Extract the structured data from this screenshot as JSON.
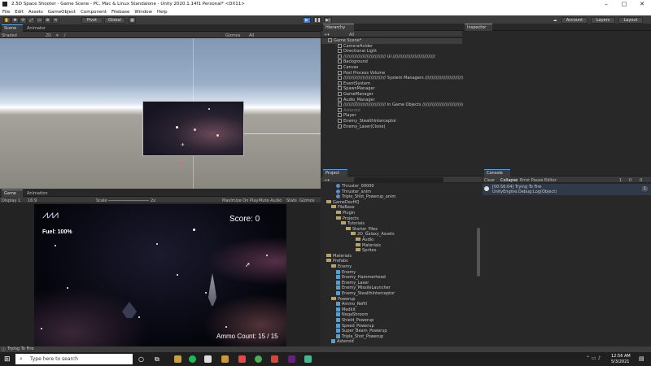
{
  "window": {
    "title": "2.5D Space Shooter - Game Scene - PC, Mac & Linux Standalone - Unity 2020.1.14f1 Personal* <DX11>",
    "minimize": "–",
    "maximize": "□",
    "close": "✕"
  },
  "menu": [
    "File",
    "Edit",
    "Assets",
    "GameObject",
    "Component",
    "Filebase",
    "Window",
    "Help"
  ],
  "toolbar": {
    "pivot": "Pivot",
    "global": "Global",
    "account": "Account",
    "layers": "Layers",
    "layout": "Layout"
  },
  "scene_tabs": {
    "scene": "Scene",
    "animator": "Animator"
  },
  "scene_bar": {
    "shading": "Shaded",
    "mode": "2D",
    "gizmos": "Gizmos",
    "search": "All"
  },
  "game_tabs": {
    "game": "Game",
    "animation": "Animation"
  },
  "game_bar": {
    "display": "Display 1",
    "aspect": "16:9",
    "scale_label": "Scale",
    "scale_value": "2x",
    "maximize": "Maximize On Play",
    "mute": "Mute Audio",
    "stats": "Stats",
    "gizmos": "Gizmos"
  },
  "hud": {
    "fuel": "Fuel: 100%",
    "score": "Score: 0",
    "ammo": "Ammo Count: 15 / 15"
  },
  "hierarchy": {
    "tab": "Hierarchy",
    "search": "All",
    "rows": [
      {
        "label": "Game Scene*",
        "indent": 0,
        "sel": true
      },
      {
        "label": "CameraHolder",
        "indent": 1
      },
      {
        "label": "Directional Light",
        "indent": 1
      },
      {
        "label": "/////////////////////////////// UI ///////////////////////////////",
        "indent": 1
      },
      {
        "label": "Background",
        "indent": 1
      },
      {
        "label": "Canvas",
        "indent": 1
      },
      {
        "label": "Post Process Volume",
        "indent": 1
      },
      {
        "label": "/////////////////////////////// System Managers ///////////////////////////////",
        "indent": 1
      },
      {
        "label": "EventSystem",
        "indent": 1
      },
      {
        "label": "SpawnManager",
        "indent": 1
      },
      {
        "label": "GameManager",
        "indent": 1
      },
      {
        "label": "Audio_Manager",
        "indent": 1
      },
      {
        "label": "/////////////////////////////// In Game Objects ///////////////////////////////",
        "indent": 1
      },
      {
        "label": "Asteroid",
        "indent": 1,
        "dim": true
      },
      {
        "label": "Player",
        "indent": 1
      },
      {
        "label": "Enemy_StealthInterceptor",
        "indent": 1
      },
      {
        "label": "Enemy_Laser(Clone)",
        "indent": 1
      }
    ]
  },
  "inspector": {
    "tab": "Inspector"
  },
  "project": {
    "tab": "Project",
    "rows": [
      {
        "label": "Thruster_00000",
        "indent": 2,
        "type": "asset"
      },
      {
        "label": "Thruster_anim",
        "indent": 2,
        "type": "asset"
      },
      {
        "label": "Triple_Shot_Powerup_anim",
        "indent": 2,
        "type": "asset"
      },
      {
        "label": "GameDevHQ",
        "indent": 0,
        "type": "folder"
      },
      {
        "label": "FileBase",
        "indent": 1,
        "type": "folder"
      },
      {
        "label": "Plugin",
        "indent": 2,
        "type": "folder"
      },
      {
        "label": "Projects",
        "indent": 2,
        "type": "folder"
      },
      {
        "label": "Tutorials",
        "indent": 3,
        "type": "folder"
      },
      {
        "label": "Starter_Files",
        "indent": 4,
        "type": "folder"
      },
      {
        "label": "2D_Galaxy_Assets",
        "indent": 5,
        "type": "folder"
      },
      {
        "label": "Audio",
        "indent": 6,
        "type": "folder"
      },
      {
        "label": "Materials",
        "indent": 6,
        "type": "folder"
      },
      {
        "label": "Sprites",
        "indent": 6,
        "type": "folder"
      },
      {
        "label": "Materials",
        "indent": 0,
        "type": "folder"
      },
      {
        "label": "Prefabs",
        "indent": 0,
        "type": "folder"
      },
      {
        "label": "Enemy",
        "indent": 1,
        "type": "folder"
      },
      {
        "label": "Enemy",
        "indent": 2,
        "type": "prefab"
      },
      {
        "label": "Enemy_Hammerhead",
        "indent": 2,
        "type": "prefab"
      },
      {
        "label": "Enemy_Laser",
        "indent": 2,
        "type": "prefab"
      },
      {
        "label": "Enemy_MissileLauncher",
        "indent": 2,
        "type": "prefab"
      },
      {
        "label": "Enemy_StealthInterceptor",
        "indent": 2,
        "type": "prefab"
      },
      {
        "label": "Powerup",
        "indent": 1,
        "type": "folder"
      },
      {
        "label": "Ammo_Refill",
        "indent": 2,
        "type": "prefab"
      },
      {
        "label": "Medkit",
        "indent": 2,
        "type": "prefab"
      },
      {
        "label": "NegaShroom",
        "indent": 2,
        "type": "prefab"
      },
      {
        "label": "Shield_Powerup",
        "indent": 2,
        "type": "prefab"
      },
      {
        "label": "Speed_Powerup",
        "indent": 2,
        "type": "prefab"
      },
      {
        "label": "Super_Beam_Powerup",
        "indent": 2,
        "type": "prefab"
      },
      {
        "label": "Triple_Shot_Powerup",
        "indent": 2,
        "type": "prefab"
      },
      {
        "label": "Asteroid",
        "indent": 1,
        "type": "prefab"
      }
    ]
  },
  "console": {
    "tab": "Console",
    "clear": "Clear",
    "collapse": "Collapse",
    "error_pause": "Error Pause",
    "editor": "Editor",
    "count_a": "1",
    "count_b": "0",
    "count_c": "0",
    "log_line1": "[00:56:04] Trying To Fire",
    "log_line2": "UnityEngine.Debug:Log(Object)",
    "log_count": "1"
  },
  "status": {
    "text": "Trying To Fire"
  },
  "taskbar": {
    "search": "Type here to search",
    "time": "12:56 AM",
    "date": "5/3/2021"
  },
  "colors": {
    "accent": "#5a9ae6",
    "play_button": "#3d7fd6"
  }
}
